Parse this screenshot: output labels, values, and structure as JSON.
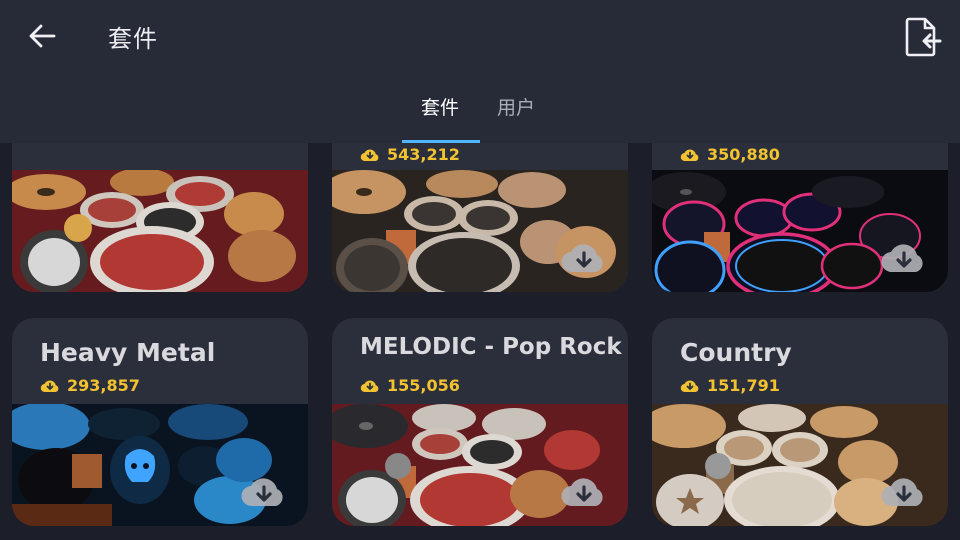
{
  "header": {
    "title": "套件",
    "back_icon": "arrow-left-icon",
    "export_icon": "file-export-icon"
  },
  "tabs": [
    {
      "label": "套件",
      "active": true
    },
    {
      "label": "用户",
      "active": false
    }
  ],
  "kits": [
    {
      "name": "",
      "downloads": "",
      "theme": "red"
    },
    {
      "name": "",
      "downloads": "543,212",
      "theme": "gold"
    },
    {
      "name": "",
      "downloads": "350,880",
      "theme": "neon"
    },
    {
      "name": "Heavy Metal",
      "downloads": "293,857",
      "theme": "blue"
    },
    {
      "name": "MELODIC - Pop Rock",
      "downloads": "155,056",
      "theme": "red2"
    },
    {
      "name": "Country",
      "downloads": "151,791",
      "theme": "country"
    }
  ],
  "colors": {
    "background": "#1c1f29",
    "header": "#272b37",
    "card": "#2b2f3b",
    "accent": "#4fb6ff",
    "download_count": "#f2c230"
  },
  "icons": {
    "download_count": "cloud-download-icon",
    "download_button": "cloud-download-icon"
  }
}
